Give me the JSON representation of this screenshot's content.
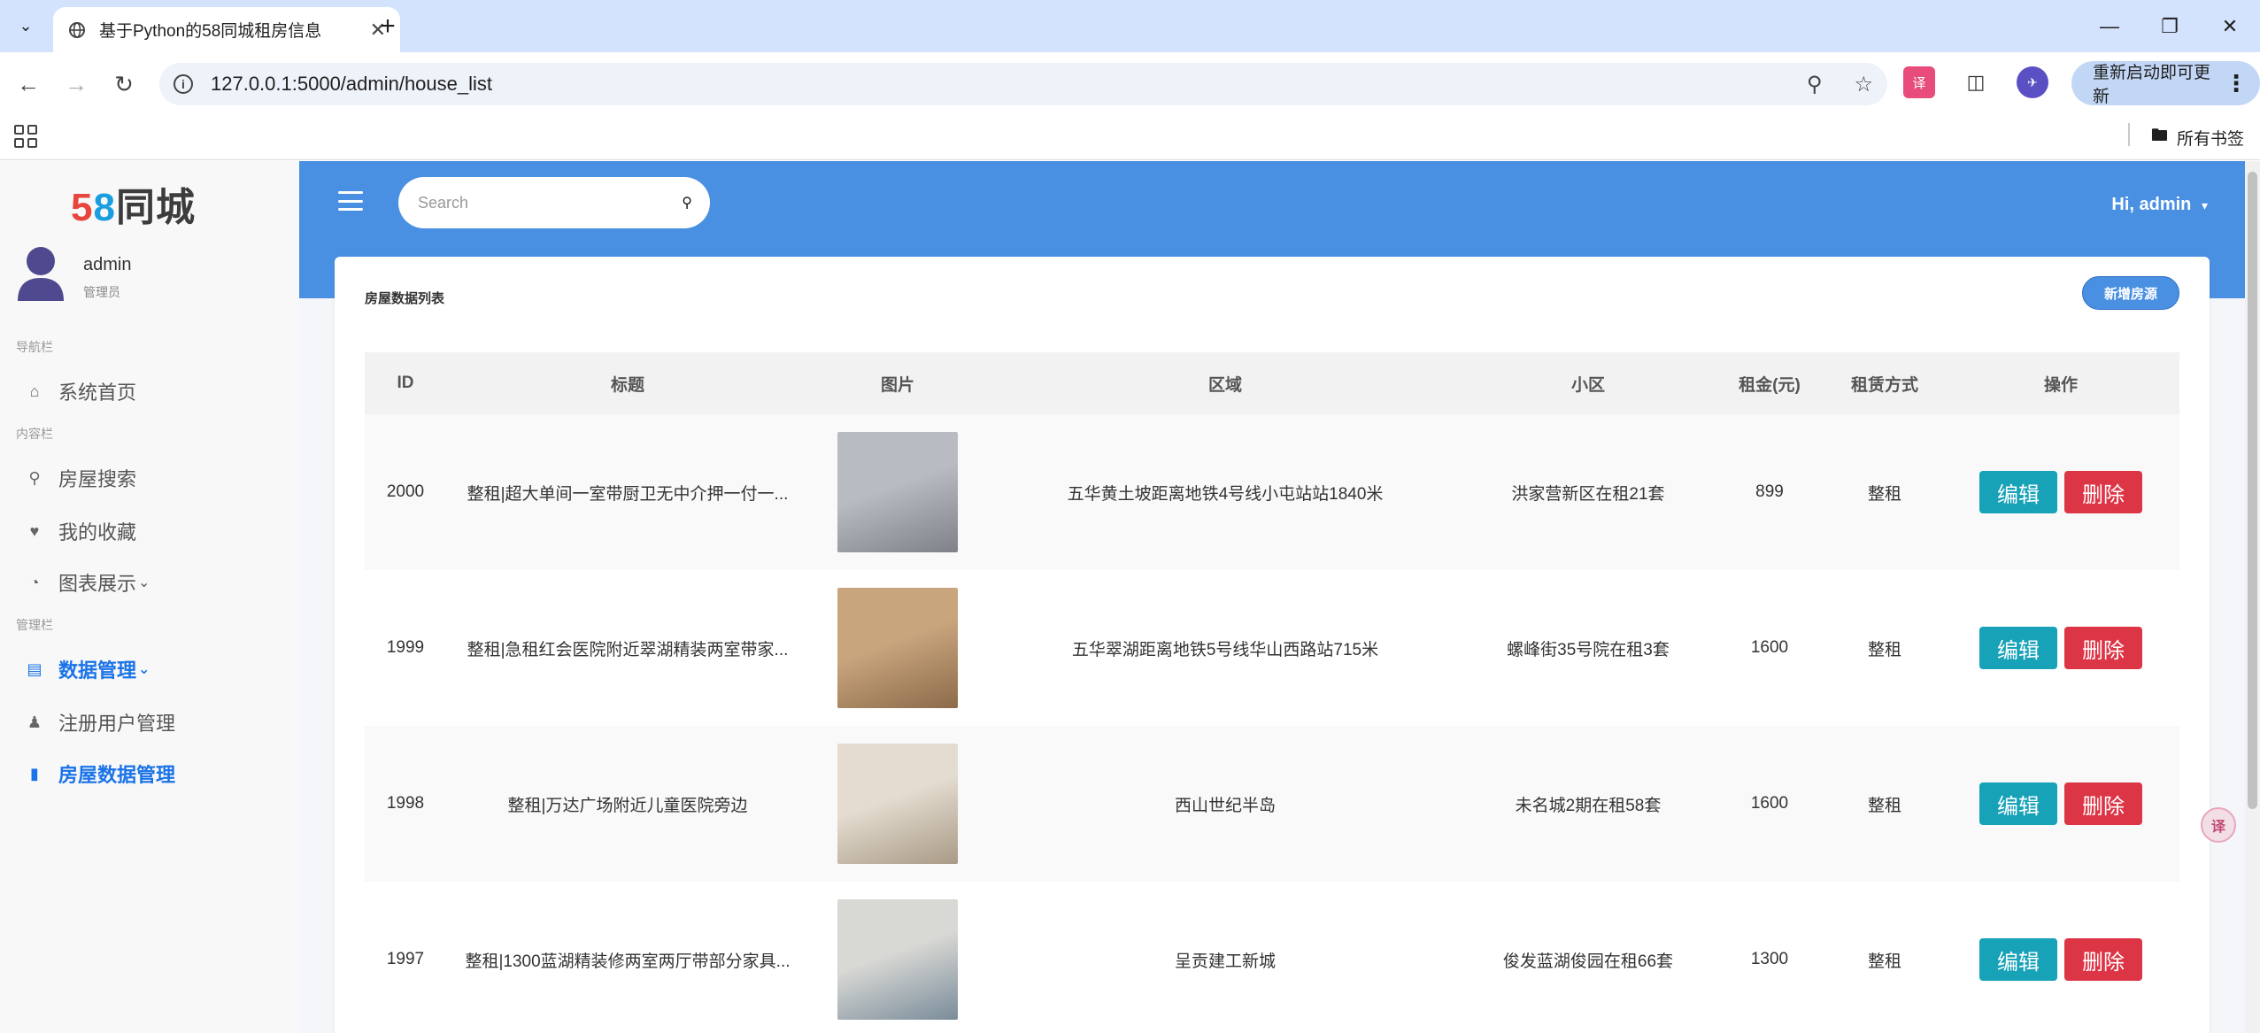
{
  "browser": {
    "tab_title": "基于Python的58同城租房信息",
    "url": "127.0.0.1:5000/admin/house_list",
    "update_label": "重新启动即可更新",
    "all_bookmarks": "所有书签"
  },
  "sidebar": {
    "logo_num_5": "5",
    "logo_num_8": "8",
    "logo_text": "同城",
    "user_name": "admin",
    "user_role": "管理员",
    "group_nav": "导航栏",
    "group_content": "内容栏",
    "group_admin": "管理栏",
    "items": [
      {
        "label": "系统首页",
        "icon": "home-icon"
      },
      {
        "label": "房屋搜索",
        "icon": "search-icon"
      },
      {
        "label": "我的收藏",
        "icon": "heart-icon"
      },
      {
        "label": "图表展示",
        "icon": "pie-chart-icon"
      },
      {
        "label": "数据管理",
        "icon": "document-icon"
      },
      {
        "label": "注册用户管理",
        "icon": "users-icon"
      },
      {
        "label": "房屋数据管理",
        "icon": "file-icon"
      }
    ]
  },
  "header": {
    "search_placeholder": "Search",
    "greeting": "Hi, admin"
  },
  "card": {
    "title": "房屋数据列表",
    "add_button": "新增房源"
  },
  "table": {
    "columns": [
      "ID",
      "标题",
      "图片",
      "区域",
      "小区",
      "租金(元)",
      "租赁方式",
      "操作"
    ],
    "edit_label": "编辑",
    "delete_label": "删除",
    "rows": [
      {
        "id": "2000",
        "title": "整租|超大单间一室带厨卫无中介押一付一...",
        "area": "五华黄土坡距离地铁4号线小屯站站1840米",
        "community": "洪家营新区在租21套",
        "price": "899",
        "type": "整租",
        "thumb_colors": [
          "#b8bcc2",
          "#7e8288"
        ]
      },
      {
        "id": "1999",
        "title": "整租|急租红会医院附近翠湖精装两室带家...",
        "area": "五华翠湖距离地铁5号线华山西路站715米",
        "community": "螺峰街35号院在租3套",
        "price": "1600",
        "type": "整租",
        "thumb_colors": [
          "#c9a57e",
          "#8c6b4a"
        ]
      },
      {
        "id": "1998",
        "title": "整租|万达广场附近儿童医院旁边",
        "area": "西山世纪半岛",
        "community": "未名城2期在租58套",
        "price": "1600",
        "type": "整租",
        "thumb_colors": [
          "#e4dcd0",
          "#a89a86"
        ]
      },
      {
        "id": "1997",
        "title": "整租|1300蓝湖精装修两室两厅带部分家具...",
        "area": "呈贡建工新城",
        "community": "俊发蓝湖俊园在租66套",
        "price": "1300",
        "type": "整租",
        "thumb_colors": [
          "#d8d8d4",
          "#7a8c9a"
        ]
      }
    ]
  }
}
